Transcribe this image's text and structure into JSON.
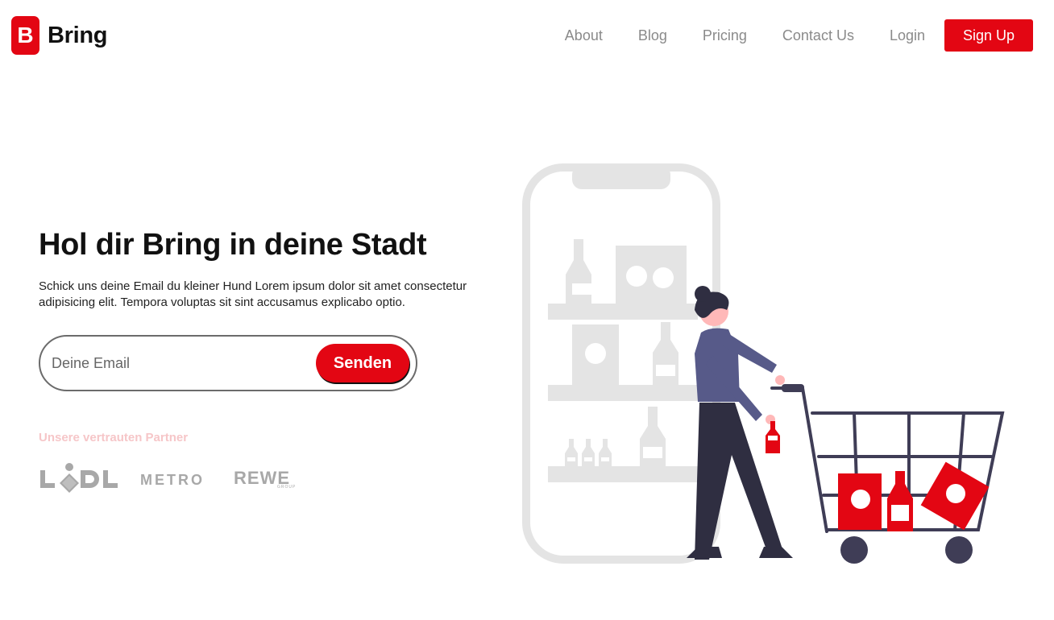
{
  "brand": {
    "mark": "B",
    "name": "Bring"
  },
  "nav": {
    "items": [
      "About",
      "Blog",
      "Pricing",
      "Contact Us",
      "Login"
    ],
    "signup_label": "Sign Up"
  },
  "hero": {
    "title": "Hol dir Bring in deine Stadt",
    "subtitle": "Schick uns deine Email du kleiner Hund Lorem ipsum dolor sit amet consectetur adipisicing elit. Tempora voluptas sit sint accusamus explicabo optio.",
    "email_placeholder": "Deine Email",
    "submit_label": "Senden"
  },
  "partners": {
    "label": "Unsere vertrauten Partner",
    "logos": [
      "LIDL",
      "METRO",
      "REWE",
      "GROUP"
    ]
  },
  "colors": {
    "accent": "#e30613",
    "muted": "#8a8a8a",
    "partner_label": "#f6c6c8"
  }
}
